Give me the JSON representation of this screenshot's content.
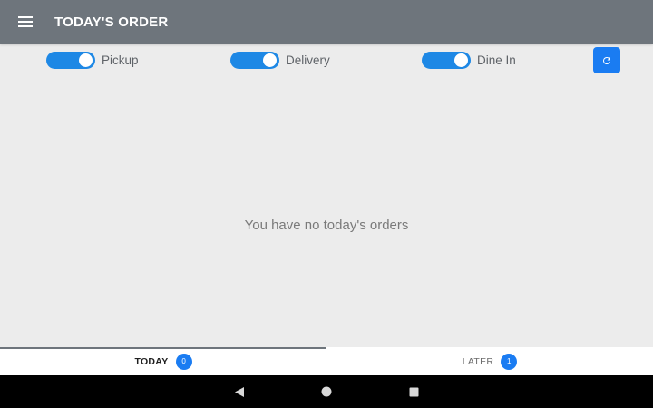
{
  "appbar": {
    "title": "TODAY'S ORDER",
    "menu_icon": "hamburger-menu-icon"
  },
  "filters": [
    {
      "label": "Pickup",
      "enabled": true
    },
    {
      "label": "Delivery",
      "enabled": true
    },
    {
      "label": "Dine In",
      "enabled": true
    }
  ],
  "refresh_icon": "refresh-icon",
  "empty_state": {
    "message": "You have no today's orders"
  },
  "tabs": [
    {
      "label": "TODAY",
      "count": "0",
      "active": true
    },
    {
      "label": "LATER",
      "count": "1",
      "active": false
    }
  ],
  "navbar": {
    "back_icon": "back-triangle-icon",
    "home_icon": "home-circle-icon",
    "recents_icon": "recents-square-icon"
  },
  "colors": {
    "appbar": "#6e757c",
    "accent": "#1a7cf2",
    "switch_on": "#1e88e5",
    "background": "#ececec"
  }
}
